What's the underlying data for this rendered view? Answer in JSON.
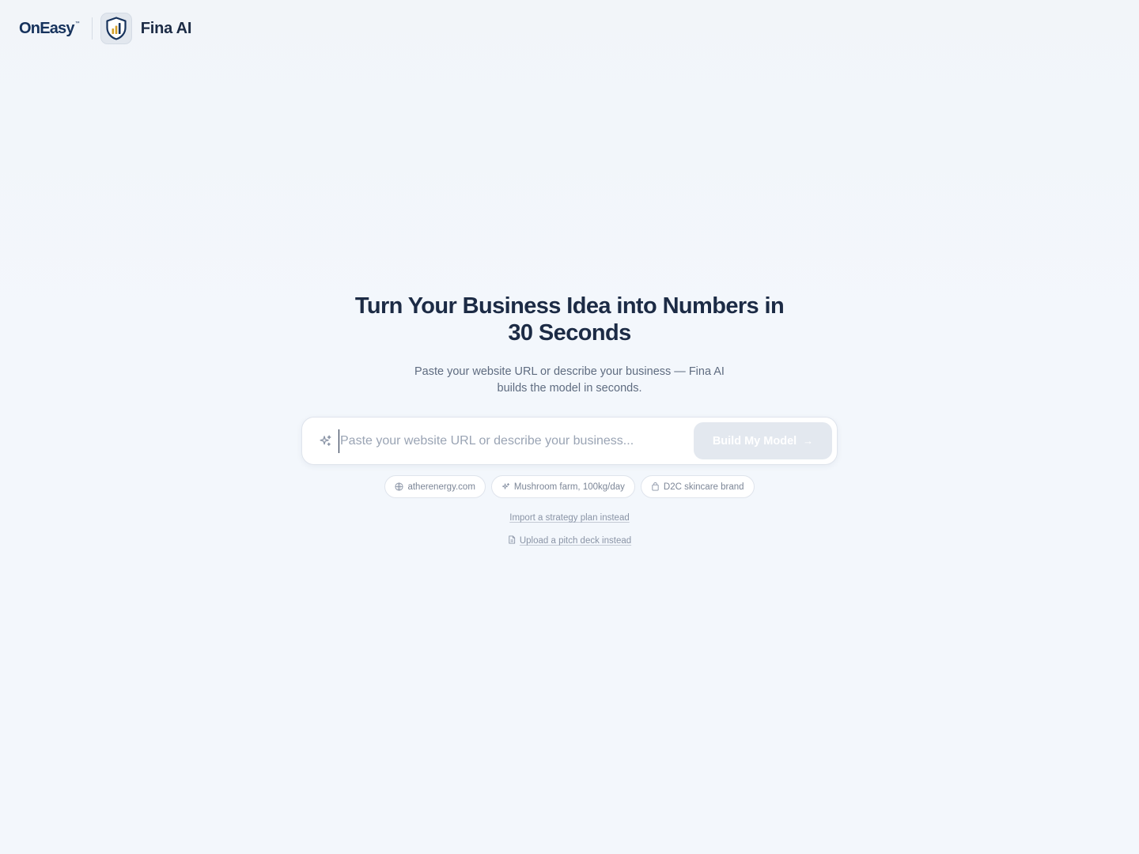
{
  "header": {
    "brand_on": "On",
    "brand_easy": "Easy",
    "brand_tm": "™",
    "app_title": "Fina AI"
  },
  "hero": {
    "title": "Turn Your Business Idea into Numbers in 30 Seconds",
    "subtitle": "Paste your website URL or describe your business — Fina AI builds the model in seconds."
  },
  "input": {
    "value": "",
    "placeholder": "Paste your website URL or describe your business..."
  },
  "build_button": {
    "label": "Build My Model",
    "arrow": "→"
  },
  "chips": [
    {
      "label": "atherenergy.com",
      "icon": "globe-icon"
    },
    {
      "label": "Mushroom farm, 100kg/day",
      "icon": "sparkles-icon"
    },
    {
      "label": "D2C skincare brand",
      "icon": "shopping-bag-icon"
    }
  ],
  "links": {
    "strategy": "Import a strategy plan instead",
    "deck": "Upload a pitch deck instead"
  },
  "colors": {
    "heading": "#1c2b45",
    "brand_navy": "#16325c",
    "logo_gold": "#d4a02a",
    "button_disabled": "#e3e8ef"
  }
}
